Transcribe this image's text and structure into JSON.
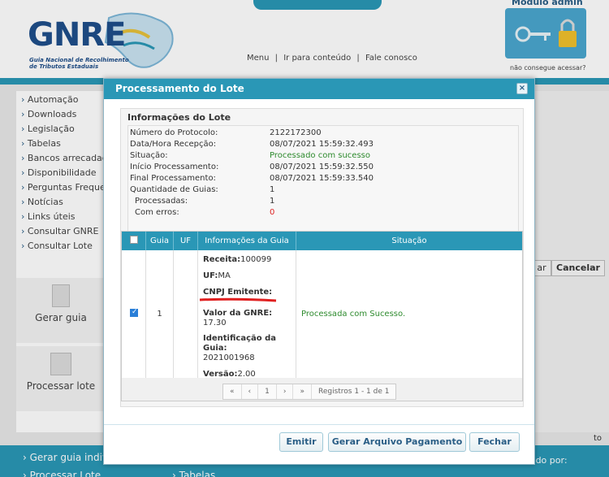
{
  "header": {
    "logo_text": "GNRE",
    "logo_sub": "Guia Nacional de Recolhimento de Tributos Estaduais",
    "links": [
      "Menu",
      "|",
      "Ir para conteúdo",
      "|",
      "Fale conosco"
    ],
    "admin_title": "Módulo admin",
    "admin_sub": "não consegue acessar?"
  },
  "sidebar": {
    "items": [
      {
        "label": "Automação"
      },
      {
        "label": "Downloads"
      },
      {
        "label": "Legislação"
      },
      {
        "label": "Tabelas"
      },
      {
        "label": "Bancos arrecadadores"
      },
      {
        "label": "Disponibilidade"
      },
      {
        "label": "Perguntas Frequentes"
      },
      {
        "label": "Notícias"
      },
      {
        "label": "Links úteis"
      },
      {
        "label": "Consultar GNRE"
      },
      {
        "label": "Consultar Lote"
      }
    ],
    "card1": "Gerar guia",
    "card2": "Processar lote"
  },
  "background": {
    "cancel_label": "Cancelar",
    "ar_label": "ar",
    "footer_left1": "› Gerar guia individual",
    "footer_left2": "› Processar Lote",
    "footer_mid": "› Tabelas",
    "footer_right": "vido por:",
    "to_label": "to"
  },
  "modal": {
    "title": "Processamento do Lote",
    "close": "×",
    "info_title": "Informações do Lote",
    "rows": [
      {
        "label": "Número do Protocolo:",
        "value": "2122172300",
        "color": "#333"
      },
      {
        "label": "Data/Hora Recepção:",
        "value": "08/07/2021 15:59:32.493",
        "color": "#333"
      },
      {
        "label": "Situação:",
        "value": "Processado com sucesso",
        "color": "#2e8b2e"
      },
      {
        "label": "Início Processamento:",
        "value": "08/07/2021 15:59:32.550",
        "color": "#333"
      },
      {
        "label": "Final Processamento:",
        "value": "08/07/2021 15:59:33.540",
        "color": "#333"
      },
      {
        "label": "Quantidade de Guias:",
        "value": "1",
        "color": "#333"
      },
      {
        "label": "  Processadas:",
        "value": "1",
        "color": "#333"
      },
      {
        "label": "  Com erros:",
        "value": "0",
        "color": "#d22"
      }
    ],
    "grid": {
      "headers": [
        "",
        "Guia",
        "UF",
        "Informações da Guia",
        "Situação"
      ],
      "row": {
        "guia": "1",
        "uf": "",
        "receita_label": "Receita:",
        "receita_value": "100099",
        "uf_label": "UF:",
        "uf_value": "MA",
        "cnpj_label": "CNPJ Emitente:",
        "valor_label": "Valor da GNRE:",
        "valor_value": "17.30",
        "ident_label": "Identificação da Guia:",
        "ident_value": "2021001968",
        "versao_label": "Versão:",
        "versao_value": "2.00",
        "situacao": "Processada com Sucesso."
      }
    },
    "pager": {
      "first": "«",
      "prev": "‹",
      "page": "1",
      "next": "›",
      "last": "»",
      "records": "Registros 1 - 1 de 1"
    },
    "buttons": {
      "emitir": "Emitir",
      "gerar": "Gerar Arquivo Pagamento",
      "fechar": "Fechar"
    }
  }
}
